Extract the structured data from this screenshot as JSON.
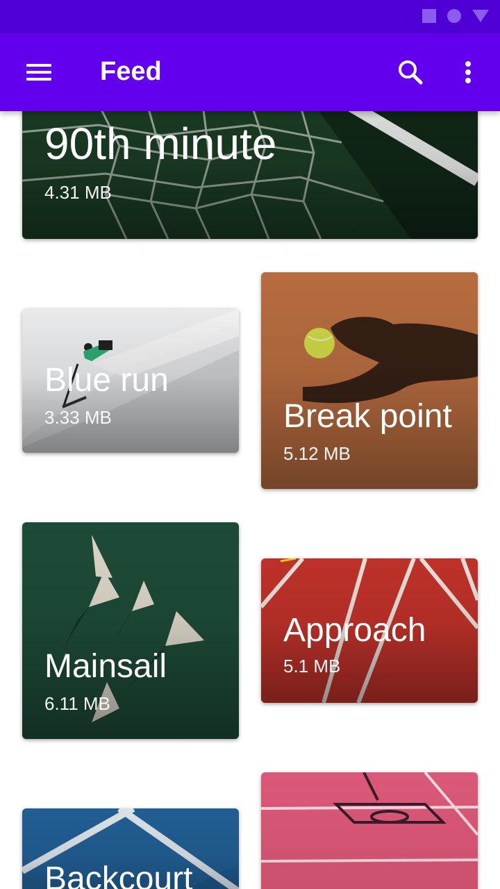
{
  "status_bar": {
    "icons": [
      "square-icon",
      "circle-icon",
      "triangle-icon"
    ],
    "color": "#4f00d4"
  },
  "app_bar": {
    "title": "Feed",
    "menu_icon": "menu-icon",
    "search_icon": "search-icon",
    "more_icon": "more-vert-icon",
    "color": "#6200ee"
  },
  "feed": {
    "cards": [
      {
        "title": "90th minute",
        "size": "4.31 MB",
        "image": "soccer-goal-net-image"
      },
      {
        "title": "Blue run",
        "size": "3.33 MB",
        "image": "skier-snow-slope-image"
      },
      {
        "title": "Break point",
        "size": "5.12 MB",
        "image": "tennis-clay-court-image"
      },
      {
        "title": "Mainsail",
        "size": "6.11 MB",
        "image": "sailboats-aerial-image"
      },
      {
        "title": "Approach",
        "size": "5.1 MB",
        "image": "running-track-image"
      },
      {
        "title": "Backcourt",
        "size": "",
        "image": "blue-court-lines-image"
      },
      {
        "title": "",
        "size": "",
        "image": "pink-basketball-court-image"
      }
    ]
  }
}
